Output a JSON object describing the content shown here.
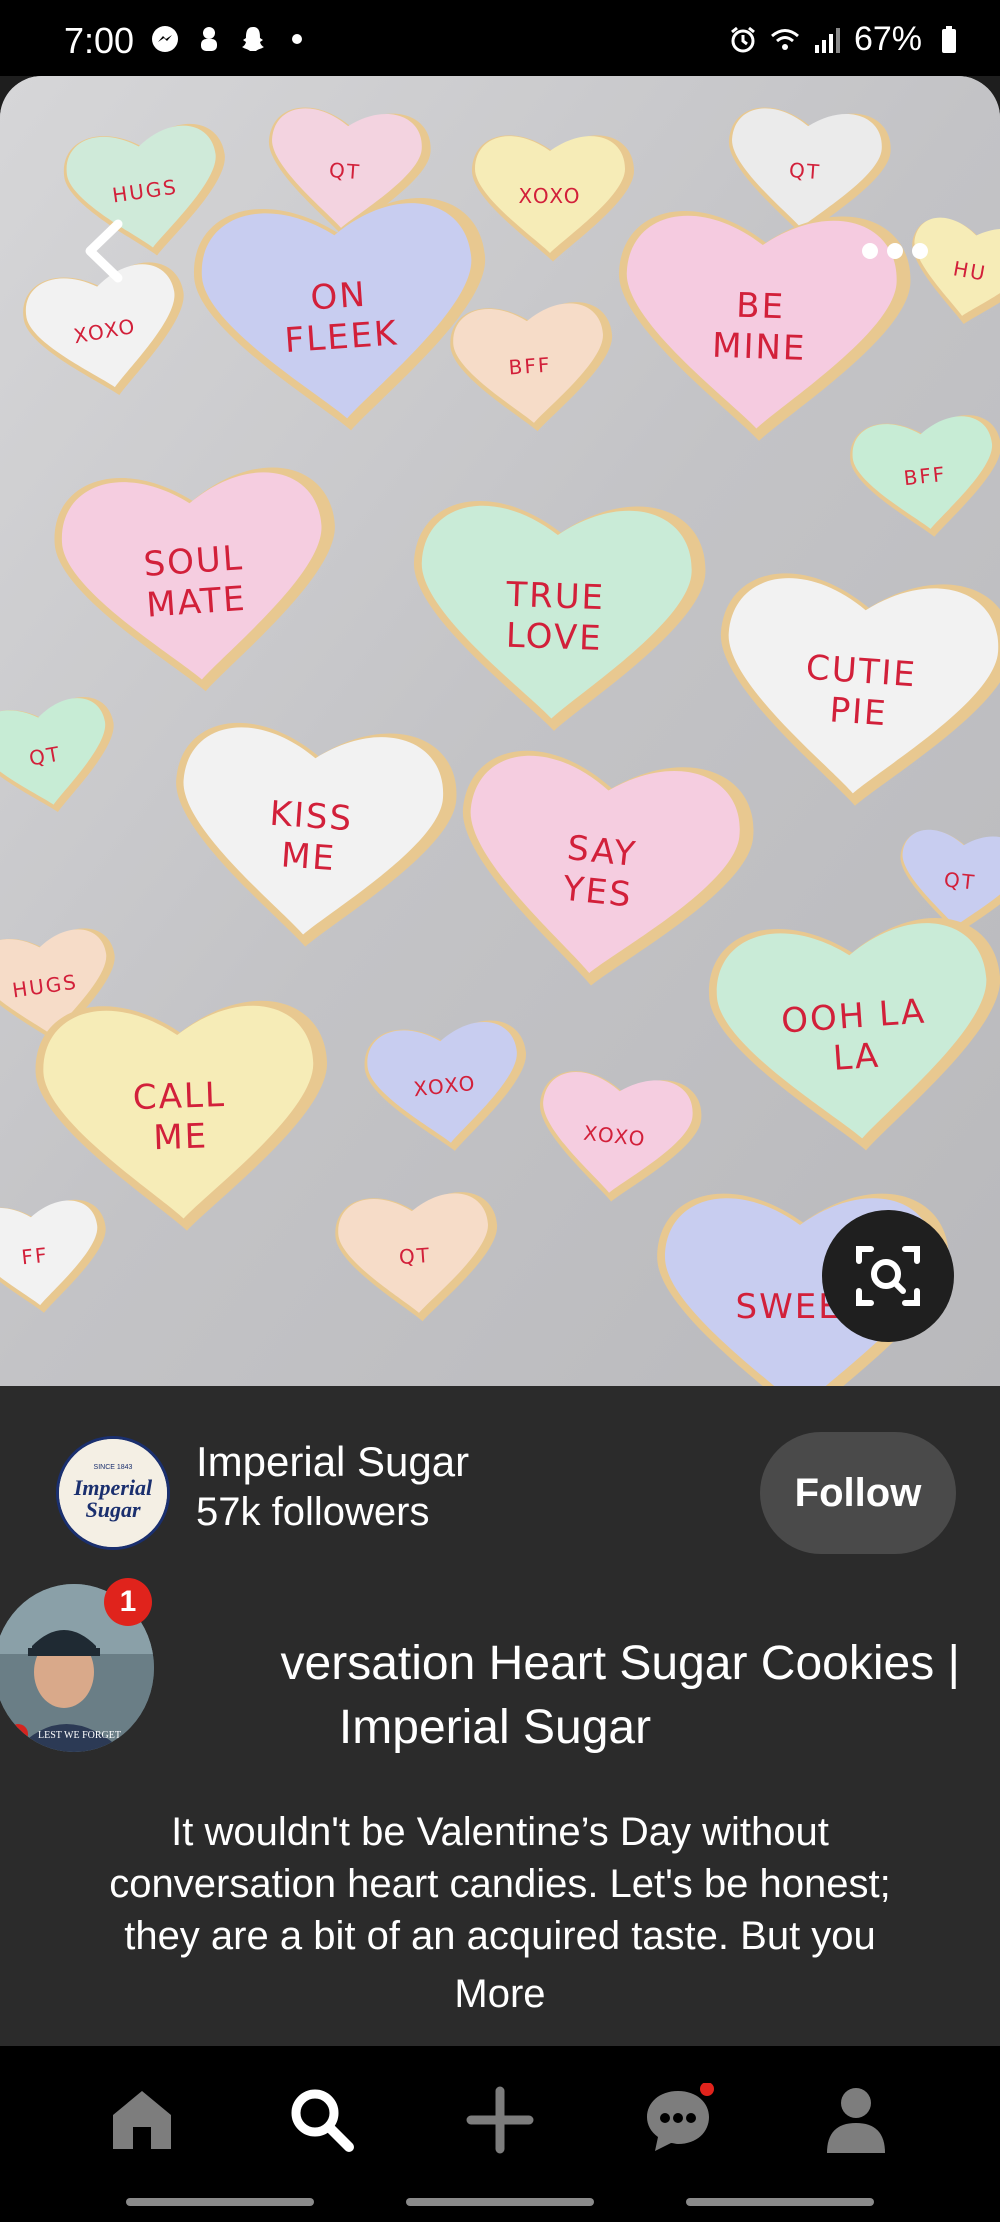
{
  "status_bar": {
    "time": "7:00",
    "battery": "67%",
    "left_icons": [
      "messenger-icon",
      "notification-icon",
      "snapchat-icon",
      "dot-icon"
    ],
    "right_icons": [
      "alarm-icon",
      "wifi-icon",
      "signal-icon",
      "battery-icon"
    ]
  },
  "hero": {
    "alt": "Conversation heart sugar cookies",
    "cookie_texts": [
      "HUGS",
      "QT",
      "XOXO",
      "QT",
      "XOXO",
      "ON FLEEK",
      "BE MINE",
      "HU",
      "BFF",
      "BFF",
      "SOUL MATE",
      "TRUE LOVE",
      "CUTIE PIE",
      "QT",
      "KISS ME",
      "SAY YES",
      "QT",
      "HUGS",
      "OOH LA LA",
      "XOXO",
      "CALL ME",
      "XOXO",
      "FF",
      "QT",
      "SWEET"
    ]
  },
  "creator": {
    "name": "Imperial Sugar",
    "followers": "57k followers",
    "logo_text": "Imperial Sugar",
    "logo_since": "SINCE 1843"
  },
  "follow_label": "Follow",
  "pin": {
    "title_line1": "versation Heart Sugar Cookies |",
    "title_line2": "Imperial Sugar",
    "desc_line1": "It wouldn't be Valentine’s Day without",
    "desc_line2": "conversation heart candies. Let's be honest;",
    "desc_line3": "they are a bit of an acquired taste. But you",
    "more_label": "More"
  },
  "chat_head": {
    "badge_count": "1",
    "caption": "LEST WE FORGET"
  },
  "nav": {
    "items": [
      "home-icon",
      "search-icon",
      "create-icon",
      "messages-icon",
      "profile-icon"
    ]
  }
}
